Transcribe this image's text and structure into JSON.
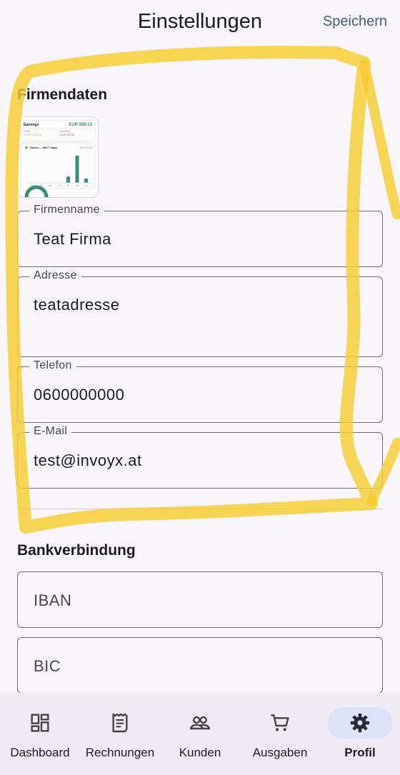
{
  "appbar": {
    "title": "Einstellungen",
    "save_label": "Speichern"
  },
  "company": {
    "section_title": "Firmendaten",
    "logo": {
      "card_title": "Earnings",
      "card_amount": "EUR 928.13",
      "income_label": "Latest",
      "income_value": "+EUR 978.13",
      "expense_label": "Expenses",
      "expense_value": "-EUR 50.00",
      "chart_title": "Hours — last 7 days",
      "chart_total": "19 h 12 m",
      "bar_levels": [
        0,
        0,
        0,
        0,
        0.22,
        0.95,
        0.15
      ],
      "day_labels": [
        "Mo",
        "Tu",
        "We",
        "Th",
        "Fr",
        "Sa",
        "Su"
      ]
    },
    "fields": {
      "name": {
        "label": "Firmenname",
        "value": "Teat Firma"
      },
      "address": {
        "label": "Adresse",
        "value": "teatadresse"
      },
      "phone": {
        "label": "Telefon",
        "value": "0600000000"
      },
      "email": {
        "label": "E-Mail",
        "value": "test@invoyx.at"
      }
    }
  },
  "bank": {
    "section_title": "Bankverbindung",
    "iban_placeholder": "IBAN",
    "bic_placeholder": "BIC"
  },
  "nav": {
    "items": [
      {
        "label": "Dashboard",
        "icon": "dashboard-icon"
      },
      {
        "label": "Rechnungen",
        "icon": "receipt-icon"
      },
      {
        "label": "Kunden",
        "icon": "people-icon"
      },
      {
        "label": "Ausgaben",
        "icon": "cart-icon"
      },
      {
        "label": "Profil",
        "icon": "gear-icon",
        "active": true
      }
    ]
  },
  "colors": {
    "accent": "#3d8a7a",
    "active_pill": "#dde2f7",
    "highlight": "#f5cc2e",
    "save_link": "#4a5a78"
  }
}
